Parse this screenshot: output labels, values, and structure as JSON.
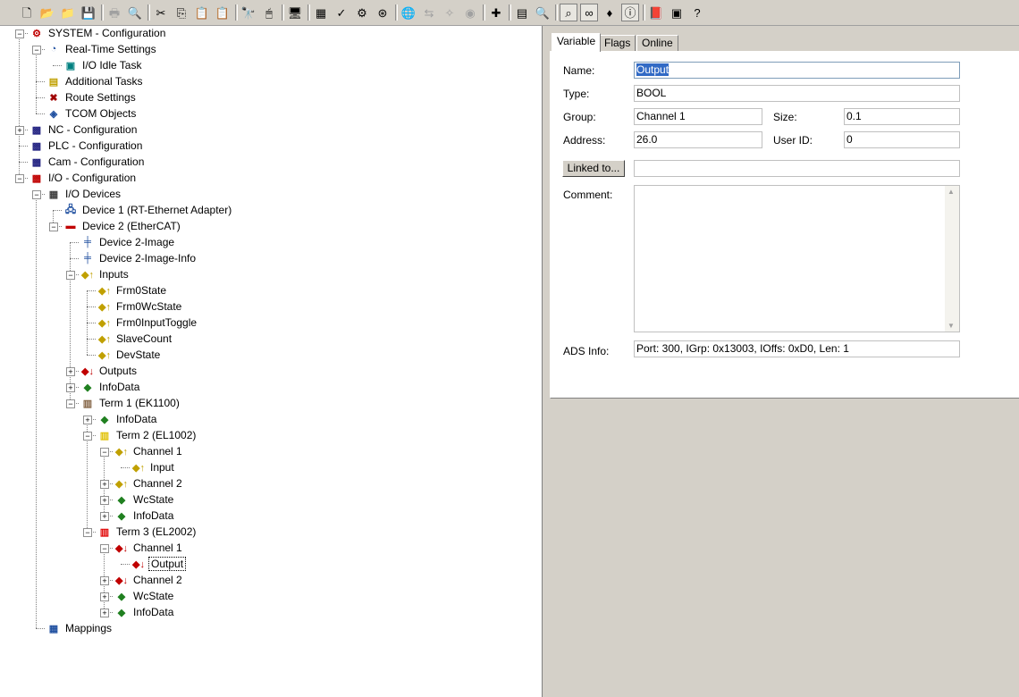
{
  "toolbar": {
    "icons": [
      {
        "name": "new-icon",
        "glyph": "🗋"
      },
      {
        "name": "open-icon",
        "glyph": "📂"
      },
      {
        "name": "open-folder-icon",
        "glyph": "📁"
      },
      {
        "name": "save-icon",
        "glyph": "💾"
      },
      {
        "name": "print-icon",
        "glyph": "🖶",
        "disabled": true
      },
      {
        "name": "print-preview-icon",
        "glyph": "🔍",
        "disabled": true
      },
      {
        "name": "cut-icon",
        "glyph": "✂"
      },
      {
        "name": "copy-icon",
        "glyph": "⎘"
      },
      {
        "name": "paste-icon",
        "glyph": "📋"
      },
      {
        "name": "paste-special-icon",
        "glyph": "📋"
      },
      {
        "name": "find-icon",
        "glyph": "🔭"
      },
      {
        "name": "mouse-icon",
        "glyph": "🖱"
      },
      {
        "name": "monitor-icon",
        "glyph": "🖥"
      },
      {
        "name": "generate-mappings-icon",
        "glyph": "▦"
      },
      {
        "name": "check-icon",
        "glyph": "✓"
      },
      {
        "name": "activate-config-icon",
        "glyph": "⚙"
      },
      {
        "name": "run-mode-icon",
        "glyph": "⊛"
      },
      {
        "name": "target-system-icon",
        "glyph": "🌐"
      },
      {
        "name": "scan-icon",
        "glyph": "⇆",
        "disabled": true
      },
      {
        "name": "wand-icon",
        "glyph": "✧",
        "disabled": true
      },
      {
        "name": "toggle-icon",
        "glyph": "◉",
        "disabled": true
      },
      {
        "name": "add-icon",
        "glyph": "✚"
      },
      {
        "name": "list-icon",
        "glyph": "▤"
      },
      {
        "name": "zoom-icon",
        "glyph": "🔍"
      },
      {
        "name": "link-search-icon",
        "glyph": "⌕",
        "pressed": true
      },
      {
        "name": "online-glasses-icon",
        "glyph": "∞",
        "pressed": true
      },
      {
        "name": "variable-icon",
        "glyph": "♦"
      },
      {
        "name": "info-icon",
        "glyph": "ⓘ",
        "pressed": true
      },
      {
        "name": "book-icon",
        "glyph": "📕"
      },
      {
        "name": "settings-icon",
        "glyph": "▣"
      },
      {
        "name": "help-icon",
        "glyph": "?"
      }
    ]
  },
  "tree": [
    {
      "label": "SYSTEM - Configuration",
      "level": 0,
      "exp": "-",
      "icon": "system-config-icon",
      "glyph": "⚙",
      "color": "#c00000"
    },
    {
      "label": "Real-Time Settings",
      "level": 1,
      "exp": "-",
      "icon": "realtime-settings-icon",
      "glyph": "◔",
      "color": "#2050a0"
    },
    {
      "label": "I/O Idle Task",
      "level": 2,
      "exp": "",
      "icon": "task-icon",
      "glyph": "▣",
      "color": "#008080"
    },
    {
      "label": "Additional Tasks",
      "level": 1,
      "exp": "",
      "icon": "additional-tasks-icon",
      "glyph": "▤",
      "color": "#c0a000"
    },
    {
      "label": "Route Settings",
      "level": 1,
      "exp": "",
      "icon": "route-settings-icon",
      "glyph": "✖",
      "color": "#a00000"
    },
    {
      "label": "TCOM Objects",
      "level": 1,
      "exp": "",
      "icon": "tcom-objects-icon",
      "glyph": "◈",
      "color": "#2050a0"
    },
    {
      "label": "NC - Configuration",
      "level": 0,
      "exp": "+",
      "icon": "nc-config-icon",
      "glyph": "▩",
      "color": "#202080"
    },
    {
      "label": "PLC - Configuration",
      "level": 0,
      "exp": "",
      "icon": "plc-config-icon",
      "glyph": "▩",
      "color": "#202080"
    },
    {
      "label": "Cam - Configuration",
      "level": 0,
      "exp": "",
      "icon": "cam-config-icon",
      "glyph": "▩",
      "color": "#202080"
    },
    {
      "label": "I/O - Configuration",
      "level": 0,
      "exp": "-",
      "icon": "io-config-icon",
      "glyph": "▩",
      "color": "#c00000"
    },
    {
      "label": "I/O Devices",
      "level": 1,
      "exp": "-",
      "icon": "io-devices-icon",
      "glyph": "▦",
      "color": "#404040"
    },
    {
      "label": "Device 1 (RT-Ethernet Adapter)",
      "level": 2,
      "exp": "",
      "icon": "ethernet-adapter-icon",
      "glyph": "🖧",
      "color": "#2050a0"
    },
    {
      "label": "Device 2 (EtherCAT)",
      "level": 2,
      "exp": "-",
      "icon": "ethercat-device-icon",
      "glyph": "▬",
      "color": "#c00000"
    },
    {
      "label": "Device 2-Image",
      "level": 3,
      "exp": "",
      "icon": "image-icon",
      "glyph": "╪",
      "color": "#2050a0"
    },
    {
      "label": "Device 2-Image-Info",
      "level": 3,
      "exp": "",
      "icon": "image-info-icon",
      "glyph": "╪",
      "color": "#2050a0"
    },
    {
      "label": "Inputs",
      "level": 3,
      "exp": "-",
      "icon": "inputs-icon",
      "glyph": "◆↑",
      "color": "#c0a000"
    },
    {
      "label": "Frm0State",
      "level": 4,
      "exp": "",
      "icon": "input-var-icon",
      "glyph": "◆↑",
      "color": "#c0a000"
    },
    {
      "label": "Frm0WcState",
      "level": 4,
      "exp": "",
      "icon": "input-var-icon",
      "glyph": "◆↑",
      "color": "#c0a000"
    },
    {
      "label": "Frm0InputToggle",
      "level": 4,
      "exp": "",
      "icon": "input-var-icon",
      "glyph": "◆↑",
      "color": "#c0a000"
    },
    {
      "label": "SlaveCount",
      "level": 4,
      "exp": "",
      "icon": "input-var-icon",
      "glyph": "◆↑",
      "color": "#c0a000"
    },
    {
      "label": "DevState",
      "level": 4,
      "exp": "",
      "icon": "input-var-icon",
      "glyph": "◆↑",
      "color": "#c0a000"
    },
    {
      "label": "Outputs",
      "level": 3,
      "exp": "+",
      "icon": "outputs-icon",
      "glyph": "◆↓",
      "color": "#c00000"
    },
    {
      "label": "InfoData",
      "level": 3,
      "exp": "+",
      "icon": "infodata-icon",
      "glyph": "◆",
      "color": "#208020"
    },
    {
      "label": "Term 1 (EK1100)",
      "level": 3,
      "exp": "-",
      "icon": "coupler-icon",
      "glyph": "▥",
      "color": "#806040"
    },
    {
      "label": "InfoData",
      "level": 4,
      "exp": "+",
      "icon": "infodata-icon",
      "glyph": "◆",
      "color": "#208020"
    },
    {
      "label": "Term 2 (EL1002)",
      "level": 4,
      "exp": "-",
      "icon": "input-terminal-icon",
      "glyph": "▥",
      "color": "#e0c000"
    },
    {
      "label": "Channel 1",
      "level": 5,
      "exp": "-",
      "icon": "input-channel-icon",
      "glyph": "◆↑",
      "color": "#c0a000"
    },
    {
      "label": "Input",
      "level": 6,
      "exp": "",
      "icon": "input-var-icon",
      "glyph": "◆↑",
      "color": "#c0a000"
    },
    {
      "label": "Channel 2",
      "level": 5,
      "exp": "+",
      "icon": "input-channel-icon",
      "glyph": "◆↑",
      "color": "#c0a000"
    },
    {
      "label": "WcState",
      "level": 5,
      "exp": "+",
      "icon": "wcstate-icon",
      "glyph": "◆",
      "color": "#208020"
    },
    {
      "label": "InfoData",
      "level": 5,
      "exp": "+",
      "icon": "infodata-icon",
      "glyph": "◆",
      "color": "#208020"
    },
    {
      "label": "Term 3 (EL2002)",
      "level": 4,
      "exp": "-",
      "icon": "output-terminal-icon",
      "glyph": "▥",
      "color": "#e00000"
    },
    {
      "label": "Channel 1",
      "level": 5,
      "exp": "-",
      "icon": "output-channel-icon",
      "glyph": "◆↓",
      "color": "#c00000"
    },
    {
      "label": "Output",
      "level": 6,
      "exp": "",
      "icon": "output-var-icon",
      "glyph": "◆↓",
      "color": "#c00000",
      "selected": true
    },
    {
      "label": "Channel 2",
      "level": 5,
      "exp": "+",
      "icon": "output-channel-icon",
      "glyph": "◆↓",
      "color": "#c00000"
    },
    {
      "label": "WcState",
      "level": 5,
      "exp": "+",
      "icon": "wcstate-icon",
      "glyph": "◆",
      "color": "#208020"
    },
    {
      "label": "InfoData",
      "level": 5,
      "exp": "+",
      "icon": "infodata-icon",
      "glyph": "◆",
      "color": "#208020"
    },
    {
      "label": "Mappings",
      "level": 1,
      "exp": "",
      "icon": "mappings-icon",
      "glyph": "▦",
      "color": "#2050a0"
    }
  ],
  "tabs": {
    "variable": "Variable",
    "flags": "Flags",
    "online": "Online"
  },
  "form": {
    "name_label": "Name:",
    "name_value": "Output",
    "type_label": "Type:",
    "type_value": "BOOL",
    "group_label": "Group:",
    "group_value": "Channel 1",
    "size_label": "Size:",
    "size_value": "0.1",
    "address_label": "Address:",
    "address_value": "26.0",
    "userid_label": "User ID:",
    "userid_value": "0",
    "linked_button": "Linked to...",
    "linked_value": "",
    "comment_label": "Comment:",
    "comment_value": "",
    "ads_label": "ADS Info:",
    "ads_value": "Port: 300, IGrp: 0x13003, IOffs: 0xD0, Len: 1"
  }
}
